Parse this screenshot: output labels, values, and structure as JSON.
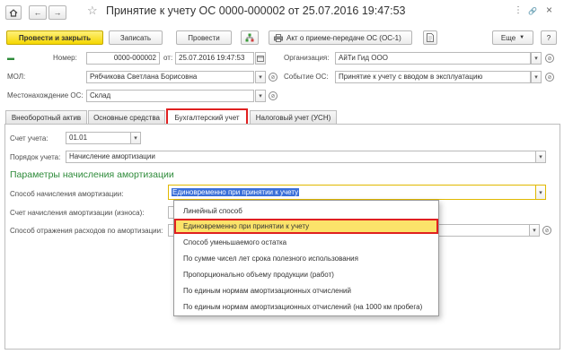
{
  "window": {
    "title": "Принятие к учету ОС 0000-000002 от 25.07.2016 19:47:53",
    "home_icon": "home-icon",
    "back_glyph": "←",
    "forward_glyph": "→",
    "star_glyph": "☆",
    "more_glyph": "⋮",
    "link_glyph": "🔗",
    "close_glyph": "×"
  },
  "toolbar": {
    "post_close": "Провести и закрыть",
    "save": "Записать",
    "post": "Провести",
    "act_print": "Акт о приеме-передаче ОС (ОС-1)",
    "more": "Еще",
    "help": "?"
  },
  "header": {
    "number_label": "Номер:",
    "number_value": "0000-000002",
    "date_label": "от:",
    "date_value": "25.07.2016 19:47:53",
    "org_label": "Организация:",
    "org_value": "АйТи Гид ООО",
    "mol_label": "МОЛ:",
    "mol_value": "Рябчикова Светлана Борисовна",
    "event_label": "Событие ОС:",
    "event_value": "Принятие к учету с вводом в эксплуатацию",
    "location_label": "Местонахождение ОС:",
    "location_value": "Склад"
  },
  "tabs": [
    {
      "label": "Внеоборотный актив"
    },
    {
      "label": "Основные средства"
    },
    {
      "label": "Бухгалтерский учет"
    },
    {
      "label": "Налоговый учет (УСН)"
    }
  ],
  "accounting": {
    "account_label": "Счет учета:",
    "account_value": "01.01",
    "order_label": "Порядок учета:",
    "order_value": "Начисление амортизации",
    "section_title": "Параметры начисления амортизации",
    "method_label": "Способ начисления амортизации:",
    "method_value": "Единовременно при принятии к учету",
    "depr_account_label": "Счет начисления амортизации (износа):",
    "expense_label": "Способ отражения расходов по амортизации:"
  },
  "dropdown": {
    "items": [
      "Линейный способ",
      "Единовременно при принятии к учету",
      "Способ уменьшаемого остатка",
      "По сумме чисел лет срока полезного использования",
      "Пропорционально объему продукции (работ)",
      "По единым нормам амортизационных отчислений",
      "По единым нормам амортизационных отчислений (на 1000 км пробега)"
    ],
    "selected_index": 1
  },
  "colors": {
    "primary_button": "#f5d700",
    "section_title": "#2e8b3a",
    "highlight_border": "#e02020",
    "selection": "#3a6fd8",
    "dropdown_selected": "#fbe36a"
  }
}
